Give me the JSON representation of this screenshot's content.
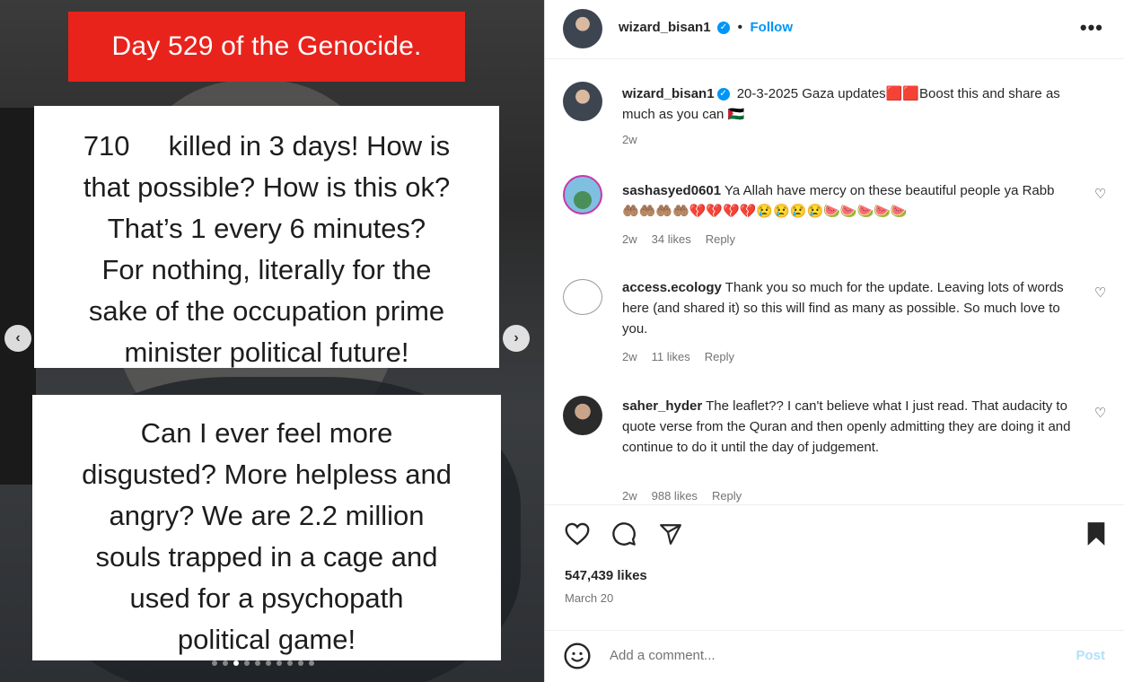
{
  "media": {
    "banner": "Day 529 of the Genocide.",
    "card1_lines": [
      "710     killed in 3 days! How is",
      "that possible? How is this ok?",
      "That’s 1 every 6 minutes?",
      "For nothing, literally for the",
      "sake of the occupation prime",
      "minister political future!"
    ],
    "card2_lines": [
      "Can I ever feel more",
      "disgusted? More helpless and",
      "angry? We are 2.2 million",
      "souls trapped in a cage and",
      "used for a psychopath",
      "political game!"
    ],
    "prev_icon": "chevron-left-icon",
    "next_icon": "chevron-right-icon"
  },
  "header": {
    "username": "wizard_bisan1",
    "separator": "•",
    "follow": "Follow",
    "more_icon": "more-horizontal-icon"
  },
  "caption": {
    "username": "wizard_bisan1",
    "text": " 20-3-2025 Gaza updates🟥🟥Boost this and share as much as you can 🇵🇸",
    "time": "2w"
  },
  "comments": [
    {
      "username": "sashasyed0601",
      "text": " Ya Allah have mercy on these beautiful people ya Rabb 🤲🏽🤲🏽🤲🏽🤲🏽💔💔💔💔😢😢😢😢🍉🍉🍉🍉🍉",
      "time": "2w",
      "likes": "34 likes",
      "reply": "Reply"
    },
    {
      "username": "access.ecology",
      "text": " Thank you so much for the update. Leaving lots of words here (and shared it) so this will find as many as possible. So much love to you.",
      "time": "2w",
      "likes": "11 likes",
      "reply": "Reply"
    },
    {
      "username": "saher_hyder",
      "text": " The leaflet?? I can't believe what I just read. That audacity to quote verse from the Quran and then openly admitting they are doing it and continue to do it until the day of judgement.",
      "time": "2w",
      "likes": "988 likes",
      "reply": "Reply"
    }
  ],
  "actions": {
    "like_icon": "heart-icon",
    "comment_icon": "comment-icon",
    "share_icon": "send-icon",
    "save_icon": "bookmark-icon",
    "likes": "547,439 likes",
    "date": "March 20"
  },
  "add_comment": {
    "placeholder": "Add a comment...",
    "post": "Post",
    "emoji_icon": "emoji-icon"
  },
  "colors": {
    "banner_red": "#e8231c",
    "accent_blue": "#0095f6"
  }
}
